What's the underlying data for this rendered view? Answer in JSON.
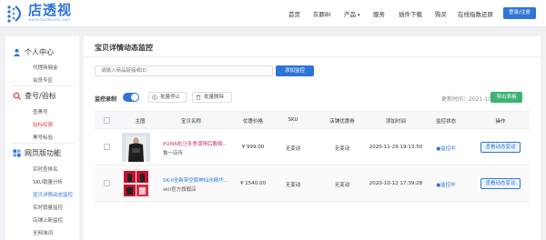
{
  "logo": {
    "title": "店透视",
    "url": "www.diantoushi.com"
  },
  "nav": {
    "items": [
      "首页",
      "灰豚BI",
      "产品",
      "服务",
      "插件下载",
      "购买",
      "在线指数还原"
    ],
    "login": "登录/注册"
  },
  "sidebar": {
    "sections": [
      {
        "title": "个人中心",
        "items": [
          "代理商佣金",
          "会员专区"
        ]
      },
      {
        "title": "查号/验标",
        "items": [
          "查黑号",
          "验标权限",
          "黑号标验"
        ]
      },
      {
        "title": "网页版功能",
        "items": [
          "实时查排名",
          "SKU销量分析",
          "宝贝详情动态监控",
          "实时销量监控",
          "店铺上新监控",
          "全网淘词"
        ]
      }
    ]
  },
  "main": {
    "title": "宝贝详情动态监控",
    "url_placeholder": "请输入商品链接或ID",
    "add_button": "添加监控",
    "toolbar_label": "监控录制",
    "batch_pause": "批量停止",
    "batch_delete": "批量删除",
    "update_time": "更新时间：2021-10-31",
    "export": "导出表格",
    "columns": [
      "主图",
      "宝贝名称",
      "优惠价格",
      "SKU",
      "店铺优惠券",
      "添加时间",
      "监控状态",
      "操作"
    ],
    "rows": [
      {
        "name_line1": "PUMA彪马冬季潮博后戴棉...",
        "name_line2": "鲁一店传",
        "price": "¥ 999.00",
        "sku": "无变动",
        "coupon": "无变动",
        "time": "2020-11-29 19:13:50",
        "status": "●监控中",
        "action": "查看动态变动"
      },
      {
        "name_line1": "SK-II全新带空瓶神仙水精华...",
        "name_line2": "skii官方旗舰店",
        "price": "¥ 1540.00",
        "sku": "无变动",
        "coupon": "无变动",
        "time": "2020-10-12 17:39:28",
        "status": "●监控中",
        "action": "查看动态变动"
      }
    ]
  },
  "colors": {
    "accent": "#2f74d8",
    "export": "#3cb371",
    "product_link": "#d9326b"
  }
}
